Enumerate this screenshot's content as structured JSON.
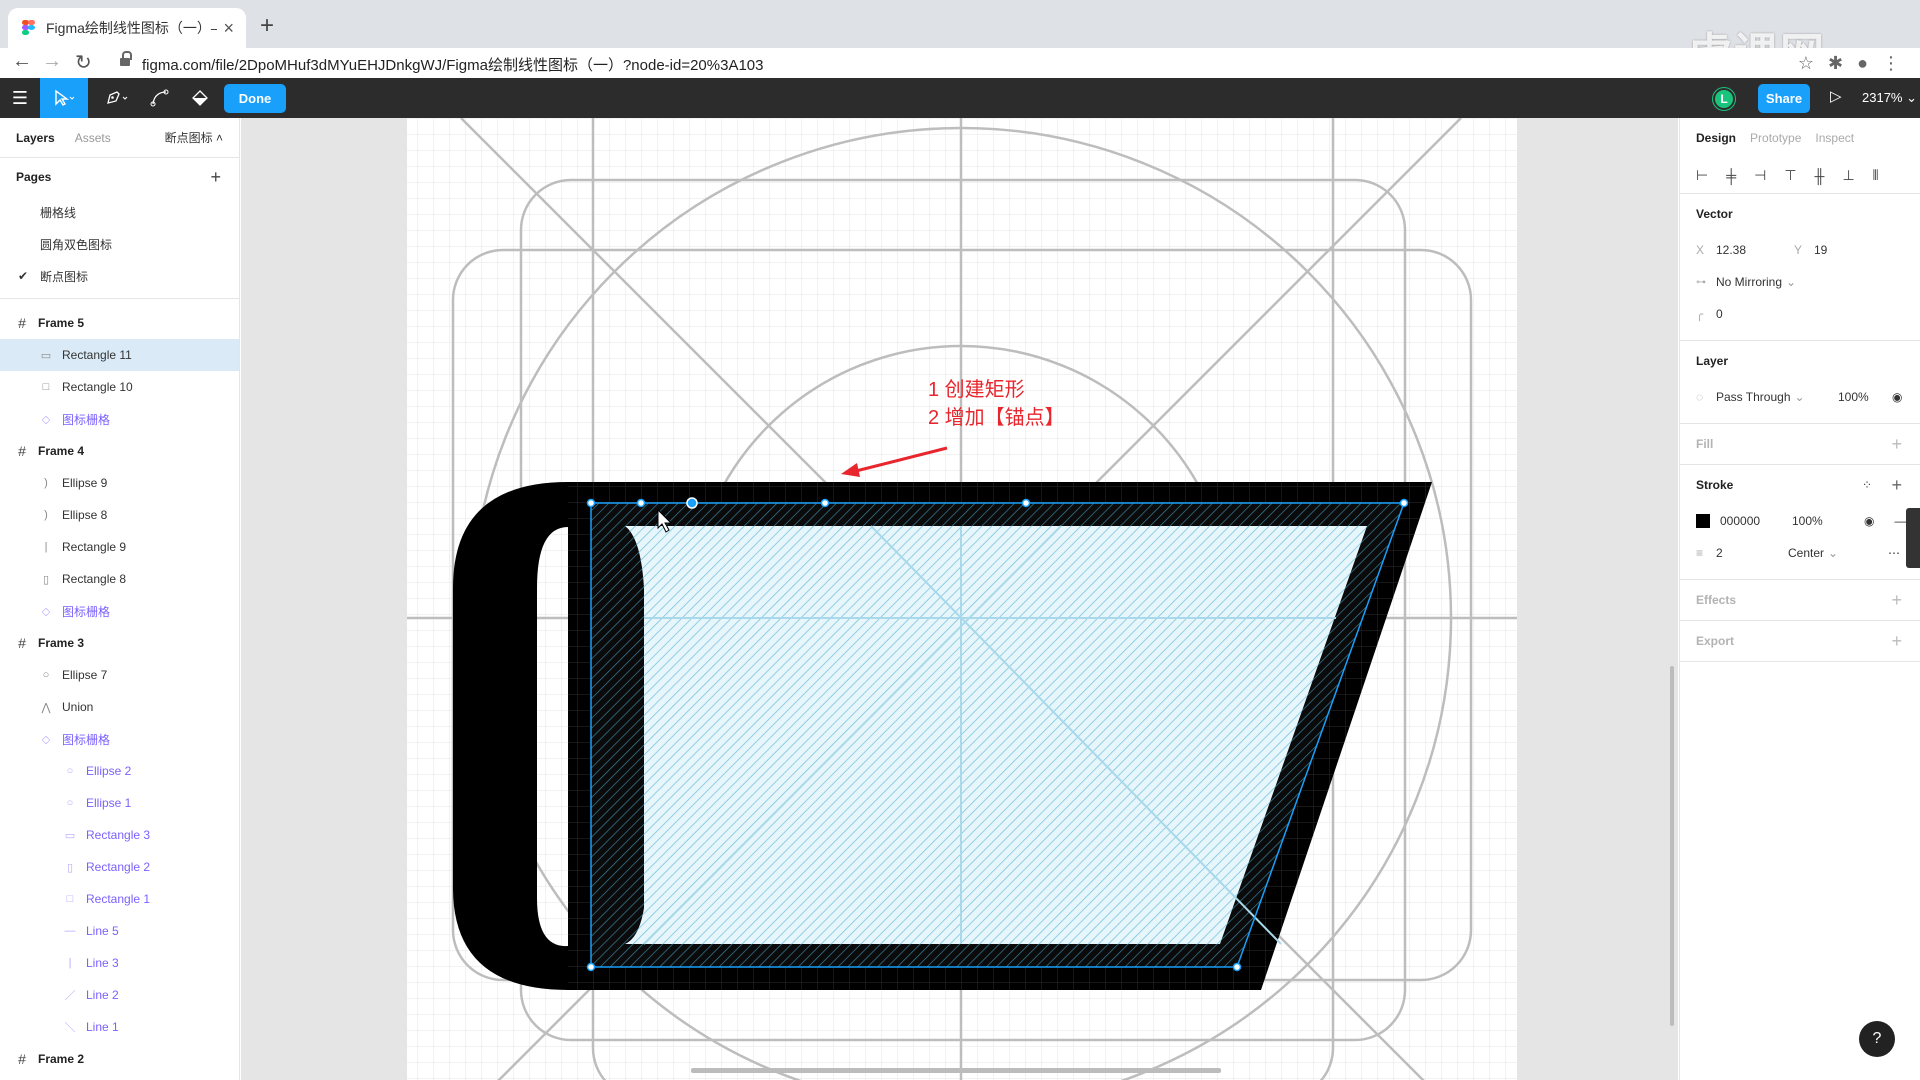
{
  "browser": {
    "tab_title": "Figma绘制线性图标（一）– Fig",
    "url": "figma.com/file/2DpoMHuf3dMYuEHJDnkgWJ/Figma绘制线性图标（一）?node-id=20%3A103",
    "watermark": "虎课网"
  },
  "toolbar": {
    "done_label": "Done",
    "avatar_initial": "L",
    "share_label": "Share",
    "zoom": "2317%"
  },
  "left_panel": {
    "tab_layers": "Layers",
    "tab_assets": "Assets",
    "current_page": "断点图标",
    "pages_header": "Pages",
    "pages": [
      "栅格线",
      "圆角双色图标",
      "断点图标"
    ],
    "layers": [
      {
        "label": "Frame 5"
      },
      {
        "label": "Rectangle 11"
      },
      {
        "label": "Rectangle 10"
      },
      {
        "label": "图标栅格"
      },
      {
        "label": "Frame 4"
      },
      {
        "label": "Ellipse 9"
      },
      {
        "label": "Ellipse 8"
      },
      {
        "label": "Rectangle 9"
      },
      {
        "label": "Rectangle 8"
      },
      {
        "label": "图标栅格"
      },
      {
        "label": "Frame 3"
      },
      {
        "label": "Ellipse 7"
      },
      {
        "label": "Union"
      },
      {
        "label": "图标栅格"
      },
      {
        "label": "Ellipse 2"
      },
      {
        "label": "Ellipse 1"
      },
      {
        "label": "Rectangle 3"
      },
      {
        "label": "Rectangle 2"
      },
      {
        "label": "Rectangle 1"
      },
      {
        "label": "Line 5"
      },
      {
        "label": "Line 3"
      },
      {
        "label": "Line 2"
      },
      {
        "label": "Line 1"
      },
      {
        "label": "Frame 2"
      }
    ]
  },
  "canvas": {
    "annotation_line1": "1 创建矩形",
    "annotation_line2": "2 增加【锚点】"
  },
  "right_panel": {
    "tab_design": "Design",
    "tab_prototype": "Prototype",
    "tab_inspect": "Inspect",
    "vector_title": "Vector",
    "x_label": "X",
    "x_value": "12.38",
    "y_label": "Y",
    "y_value": "19",
    "mirroring": "No Mirroring",
    "corner_radius": "0",
    "layer_title": "Layer",
    "blend_mode": "Pass Through",
    "layer_opacity": "100%",
    "fill_title": "Fill",
    "stroke_title": "Stroke",
    "stroke_color": "000000",
    "stroke_opacity": "100%",
    "stroke_weight": "2",
    "stroke_align": "Center",
    "effects_title": "Effects",
    "export_title": "Export",
    "help": "?"
  }
}
